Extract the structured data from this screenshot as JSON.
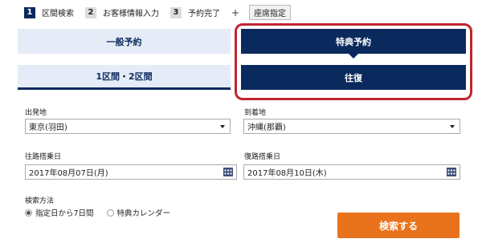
{
  "steps": [
    {
      "num": "1",
      "label": "区間検索"
    },
    {
      "num": "2",
      "label": "お客様情報入力"
    },
    {
      "num": "3",
      "label": "予約完了"
    }
  ],
  "step_plus": "+",
  "step_seat": "座席指定",
  "tabs": {
    "general": "一般予約",
    "special": "特典予約",
    "oneway": "1区間・2区間",
    "round": "往復"
  },
  "form": {
    "departure": {
      "label": "出発地",
      "value": "東京(羽田)"
    },
    "arrival": {
      "label": "到着地",
      "value": "沖縄(那覇)"
    },
    "outbound": {
      "label": "往路搭乗日",
      "value": "2017年08月07日(月)"
    },
    "return": {
      "label": "復路搭乗日",
      "value": "2017年08月10日(木)"
    },
    "method_label": "検索方法",
    "options": [
      "指定日から7日間",
      "特典カレンダー"
    ]
  },
  "search_button": "検索する",
  "colors": {
    "navy": "#0a2a5e",
    "light_tab": "#e6ecf7",
    "accent_orange": "#e8731c",
    "highlight_red": "#c0262f"
  },
  "icons": {
    "date": "calendar-icon",
    "select": "chevron-down-icon"
  }
}
